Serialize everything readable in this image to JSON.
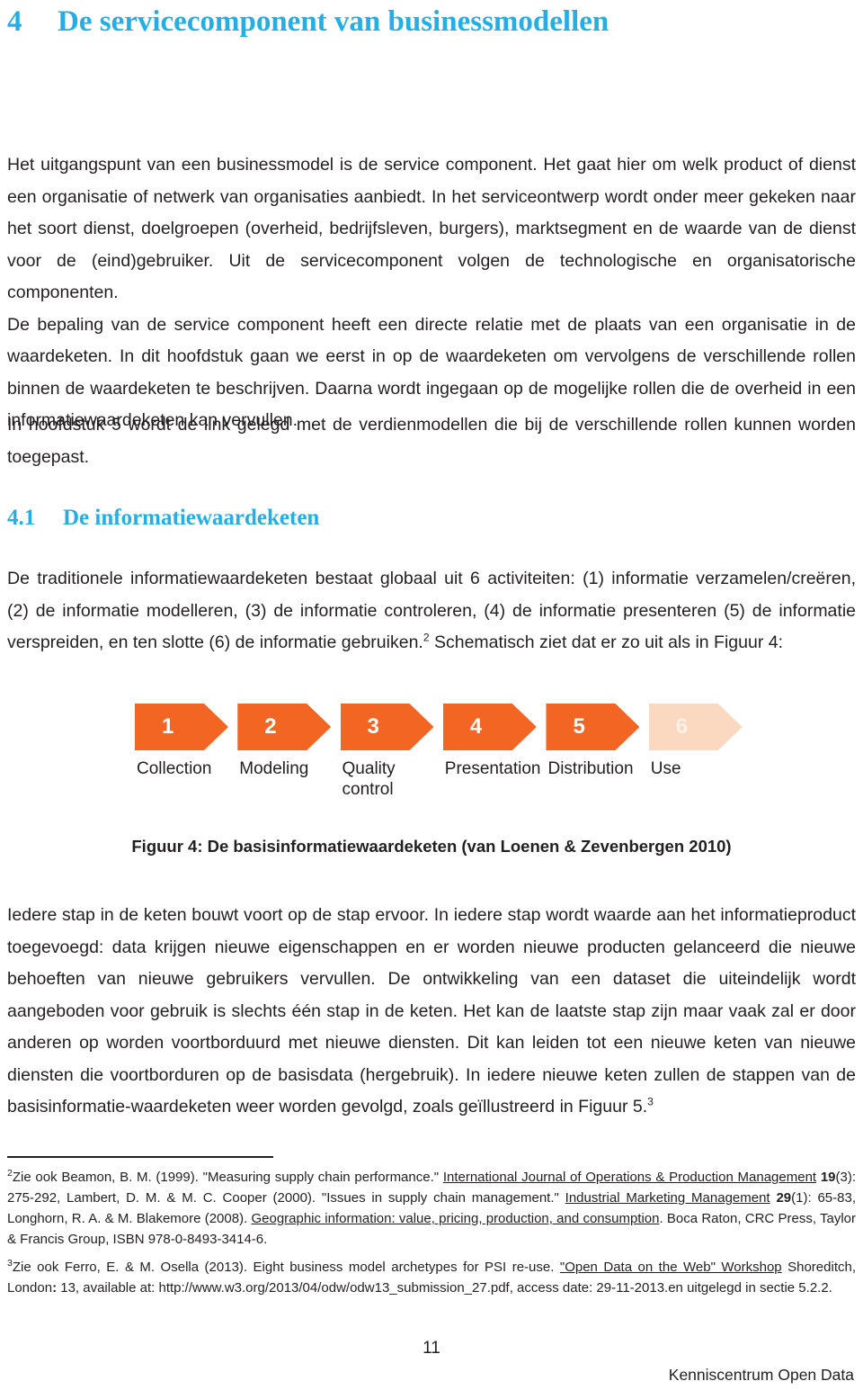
{
  "document": {
    "language": "nl",
    "accent_color": "#25AEE4",
    "text_color": "#231f20",
    "background": "#ffffff"
  },
  "chapter": {
    "number": "4",
    "title": "De servicecomponent van businessmodellen"
  },
  "intro": {
    "paragraph_1": "Het uitgangspunt van een businessmodel is de service component. Het gaat hier om welk product of dienst een organisatie of netwerk van organisaties aanbiedt. In het serviceontwerp wordt onder meer gekeken naar het soort dienst, doelgroepen (overheid, bedrijfsleven, burgers), marktsegment en de waarde van de dienst voor de (eind)gebruiker. Uit de servicecomponent volgen de technologische en organisatorische componenten.",
    "paragraph_2": "De bepaling van de service component heeft een directe relatie met de plaats van een organisatie in de waardeketen. In dit hoofdstuk gaan we eerst in op de waardeketen om vervolgens de verschillende rollen binnen de waardeketen te beschrijven. Daarna wordt ingegaan op de mogelijke rollen die de overheid in een informatiewaardeketen kan vervullen.",
    "paragraph_3": "In hoofdstuk 5 wordt de link gelegd met de verdienmodellen die bij de verschillende rollen kunnen worden toegepast."
  },
  "section": {
    "number": "4.1",
    "title": "De informatiewaardeketen",
    "paragraph_1_part1": "De traditionele informatiewaardeketen bestaat globaal uit 6 activiteiten: (1) informatie verzamelen/creëren, (2) de informatie modelleren, (3) de informatie controleren, (4) de informatie presenteren (5) de informatie verspreiden, en ten slotte (6) de informatie gebruiken.",
    "paragraph_1_footnote_marker": "2",
    "paragraph_1_part2": " Schematisch ziet dat er zo uit als in Figuur 4:"
  },
  "figure": {
    "caption": "Figuur 4: De basisinformatiewaardeketen (van Loenen & Zevenbergen 2010)",
    "active_color": "#F26522",
    "faded_color": "#FAD9C0",
    "steps": [
      {
        "number": "1",
        "label": "Collection",
        "faded": false
      },
      {
        "number": "2",
        "label": "Modeling",
        "faded": false
      },
      {
        "number": "3",
        "label": "Quality\ncontrol",
        "faded": false
      },
      {
        "number": "4",
        "label": "Presentation",
        "faded": false
      },
      {
        "number": "5",
        "label": "Distribution",
        "faded": false
      },
      {
        "number": "6",
        "label": "Use",
        "faded": true
      }
    ]
  },
  "keten": {
    "paragraph_part1": "Iedere stap in de keten bouwt voort op de stap ervoor. In iedere stap wordt waarde aan het informatieproduct toegevoegd: data krijgen nieuwe eigenschappen en er worden nieuwe producten gelanceerd die nieuwe behoeften van nieuwe gebruikers vervullen. De ontwikkeling van een dataset die uiteindelijk wordt aangeboden voor gebruik is slechts één stap in de keten. Het kan de laatste stap zijn maar vaak zal er door anderen op worden voortborduurd met nieuwe diensten. Dit kan leiden tot een nieuwe keten van nieuwe diensten die voortborduren op de basisdata (hergebruik). In iedere nieuwe keten zullen de stappen van de basisinformatie-waardeketen weer worden gevolgd, zoals geïllustreerd in Figuur 5.",
    "paragraph_footnote_marker": "3"
  },
  "footnotes": [
    {
      "marker": "2",
      "segments": [
        {
          "text": "Zie ook Beamon, B. M. (1999). \"Measuring supply chain performance.\" ",
          "style": "normal"
        },
        {
          "text": "International Journal of Operations & Production Management",
          "style": "underline"
        },
        {
          "text": " ",
          "style": "normal"
        },
        {
          "text": "19",
          "style": "bold"
        },
        {
          "text": "(3): 275-292, Lambert, D. M. & M. C. Cooper (2000). \"Issues in supply chain management.\" ",
          "style": "normal"
        },
        {
          "text": "Industrial Marketing Management",
          "style": "underline"
        },
        {
          "text": " ",
          "style": "normal"
        },
        {
          "text": "29",
          "style": "bold"
        },
        {
          "text": "(1): 65-83, Longhorn, R. A. & M. Blakemore (2008). ",
          "style": "normal"
        },
        {
          "text": "Geographic information: value, pricing, production, and consumption",
          "style": "underline"
        },
        {
          "text": ". Boca Raton, CRC Press, Taylor & Francis Group, ISBN 978-0-8493-3414-6.",
          "style": "normal"
        }
      ]
    },
    {
      "marker": "3",
      "segments": [
        {
          "text": "Zie ook Ferro, E. & M. Osella (2013). Eight business model archetypes for PSI re-use. ",
          "style": "normal"
        },
        {
          "text": "\"Open Data on the Web\" Workshop",
          "style": "underline"
        },
        {
          "text": " Shoreditch, London",
          "style": "normal"
        },
        {
          "text": ":",
          "style": "bold"
        },
        {
          "text": " 13, available at: http://www.w3.org/2013/04/odw/odw13_submission_27.pdf, access date: 29-11-2013.en uitgelegd in sectie 5.2.2.",
          "style": "normal"
        }
      ]
    }
  ],
  "footer": {
    "page_number": "11",
    "organisation": "Kenniscentrum Open Data"
  }
}
